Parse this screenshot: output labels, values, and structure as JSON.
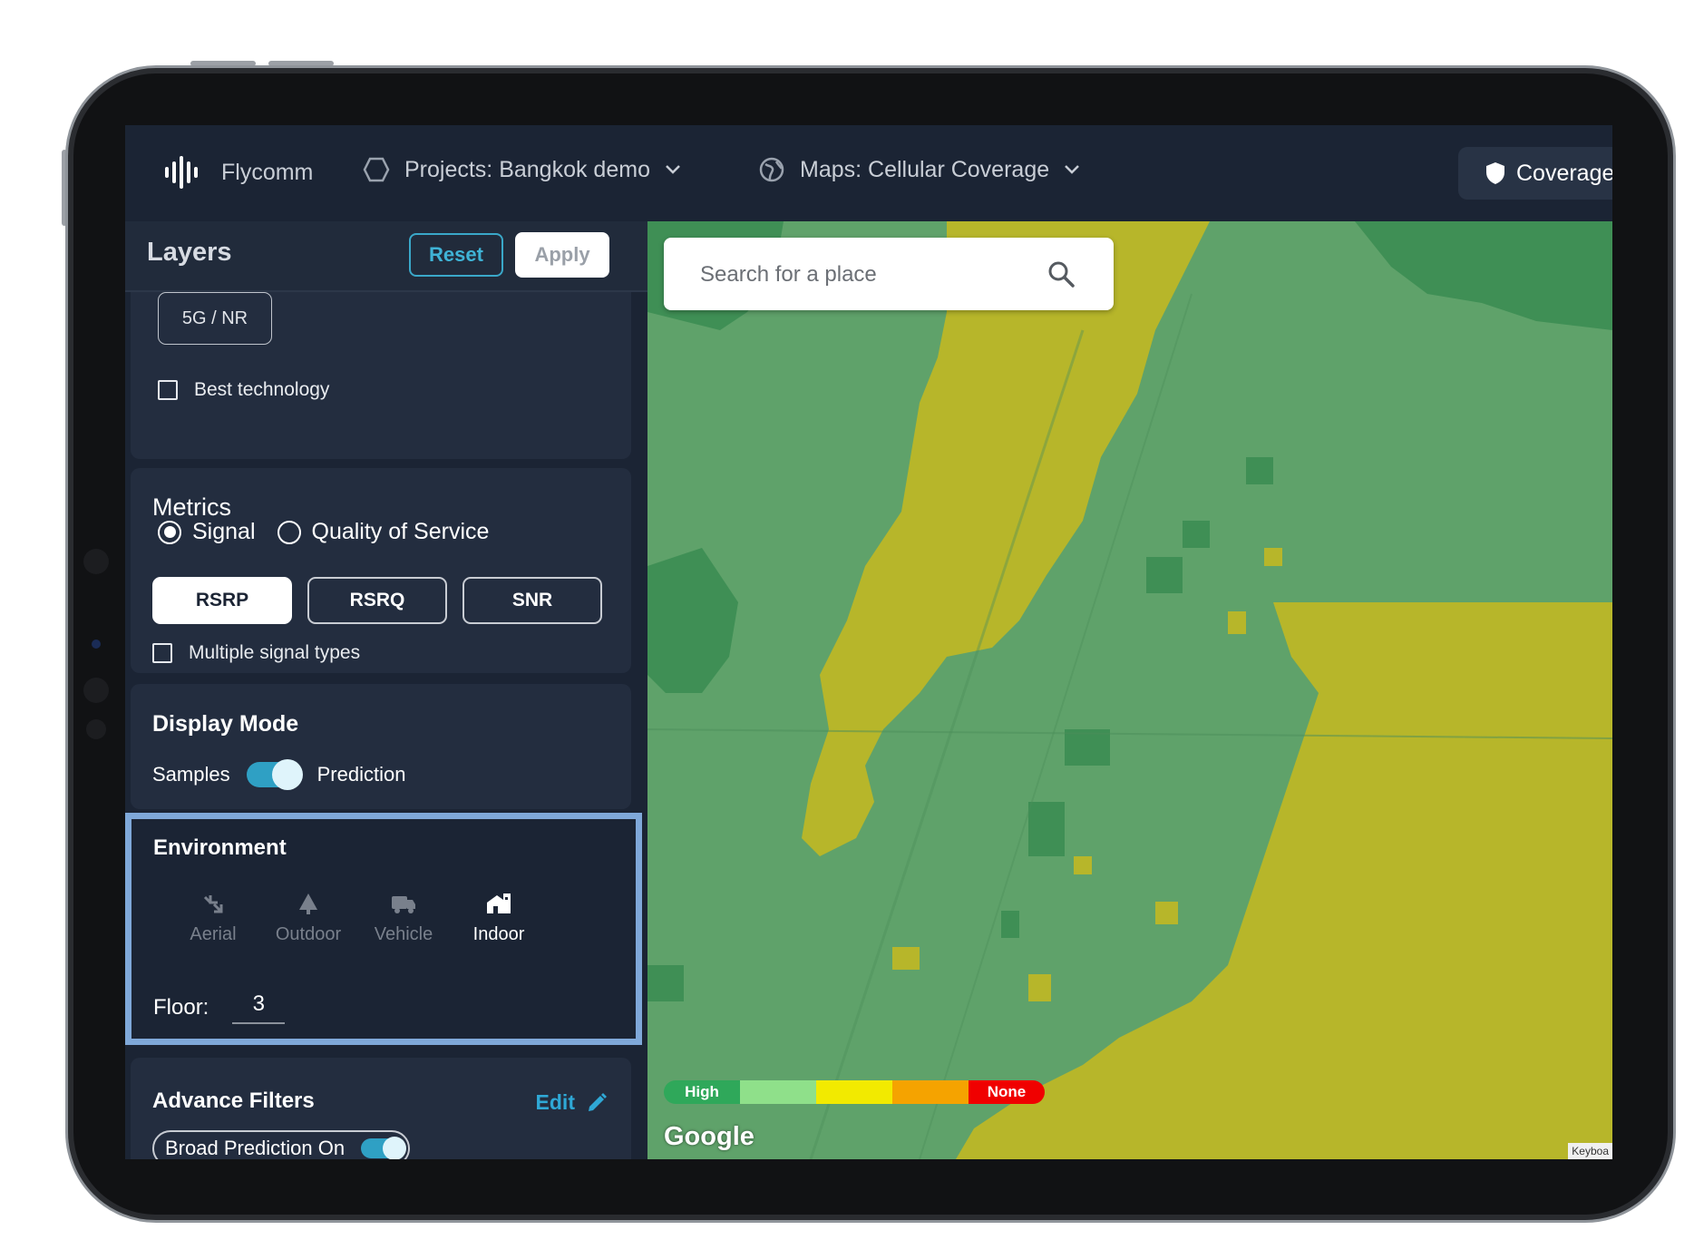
{
  "nav": {
    "brand": "Flycomm",
    "project_label": "Projects: Bangkok demo",
    "maps_label": "Maps: Cellular Coverage",
    "coverage_label": "Coverage"
  },
  "layers": {
    "title": "Layers",
    "reset_label": "Reset",
    "apply_label": "Apply"
  },
  "technology": {
    "chip_label": "5G / NR",
    "best_tech_label": "Best technology",
    "best_tech_checked": false
  },
  "metrics": {
    "title": "Metrics",
    "options": [
      "Signal",
      "Quality of Service"
    ],
    "selected": "Signal",
    "signal_types": [
      "RSRP",
      "RSRQ",
      "SNR"
    ],
    "selected_signal": "RSRP",
    "multiple_label": "Multiple signal types",
    "multiple_checked": false
  },
  "display_mode": {
    "title": "Display Mode",
    "left_label": "Samples",
    "right_label": "Prediction",
    "toggle_on": true
  },
  "environment": {
    "title": "Environment",
    "items": [
      {
        "label": "Aerial",
        "icon": "aerial-icon",
        "active": false
      },
      {
        "label": "Outdoor",
        "icon": "tree-icon",
        "active": false
      },
      {
        "label": "Vehicle",
        "icon": "truck-icon",
        "active": false
      },
      {
        "label": "Indoor",
        "icon": "building-icon",
        "active": true
      }
    ],
    "floor_label": "Floor:",
    "floor_value": "3"
  },
  "advance_filters": {
    "title": "Advance Filters",
    "edit_label": "Edit",
    "broad_label": "Broad Prediction On",
    "broad_on": true
  },
  "map": {
    "search_placeholder": "Search for a place",
    "legend_high": "High",
    "legend_none": "None",
    "legend_colors": [
      "#2fa85a",
      "#8fe08a",
      "#f2ea00",
      "#f5a300",
      "#f00000"
    ],
    "attribution": "Google",
    "keyboard_label": "Keyboa"
  },
  "colors": {
    "accent": "#2fa8d6",
    "panel_bg": "#1b2434",
    "highlight_border": "#7fa8d9",
    "coverage_green": "#5fa26a",
    "coverage_yellow": "#b7b62a"
  }
}
